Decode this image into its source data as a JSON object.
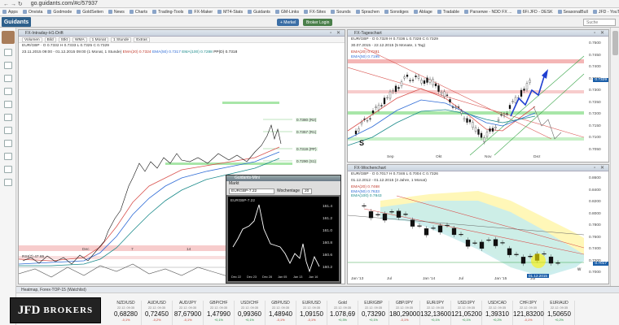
{
  "browser": {
    "url": "go.guidants.com/#c/57937",
    "nav": "← → ↻"
  },
  "bookmarks": [
    "Apps",
    "Onvista",
    "Godmode",
    "GoldSeiten",
    "News",
    "Charts",
    "Trading-Tools",
    "FX-Maker",
    "MT4-Stats",
    "Guidants",
    "GM-Links",
    "FX-Sites",
    "Sounds",
    "Sprachen",
    "Sonstiges",
    "Ablage",
    "Tradable",
    "Parserwe - NDD FX ...",
    "6Fi JFD - DESK",
    "SeasonalBull",
    "JFD - YouTube"
  ],
  "app": {
    "logo": "Guidants",
    "btn_merkel": "+ Merkel",
    "btn_broker": "Broker Login",
    "search": "Suche"
  },
  "left_chart": {
    "title": "FX-Intraday-H1-Drift",
    "toolbar": [
      "Volumen",
      "Bild",
      "Stkt",
      "WMA",
      "1 Monat",
      "1 Stunde",
      "Extras"
    ],
    "info_line1": "EUR/GBP · O 0.7332  H 0.7333  L 0.7325  C 0.7329",
    "info_line2_prefix": "23.11.2015 09:00 - 01.12.2015 09:00 (1 Monat, 1 Stunde)",
    "ema20": "EMA(20) 0.7324",
    "ema50": "EMA(50) 0.7317",
    "ema100": "EMA(100) 0.7288",
    "pp": "PP(D) 0.7318",
    "levels": [
      {
        "label": "0.7380 (R2)",
        "y": 92
      },
      {
        "label": "0.7357 (R1)",
        "y": 107
      },
      {
        "label": "0.7319 (PP)",
        "y": 128
      },
      {
        "label": "0.7290 (S1)",
        "y": 143
      },
      {
        "label": "0.7251 (S2)",
        "y": 163
      },
      {
        "label": "0.7223 (S3)",
        "y": 178
      }
    ],
    "xlabels": [
      "Dec",
      "7",
      "14"
    ],
    "rsi_label": "RSI(7)  47.65"
  },
  "right_top": {
    "title": "FX-Tageschart",
    "info_line1": "EUR/GBP · O 0.7329  H 0.7336  L 0.7328  C 0.7329",
    "info_line2": "30.07.2015 - 22.12.2015 (5 Monate, 1 Tag)",
    "ema20": "EMA(20) 0.7281",
    "ema50": "EMA(50) 0.7195",
    "ema100": "EMA(100) 0.7220",
    "yticks": [
      "0.7500",
      "0.7450",
      "0.7400",
      "0.7350",
      "0.7300",
      "0.7250",
      "0.7200",
      "0.7150",
      "0.7100",
      "0.7050"
    ],
    "xlabels": [
      "Sep",
      "Okt",
      "Nov",
      "Dez"
    ],
    "price_tag": "0.7329",
    "s_label": "S"
  },
  "right_bottom": {
    "title": "FX-Wochenchart",
    "info_line1": "EUR/GBP · O 0.7017  H 0.7346  L 0.7004  C 0.7326",
    "info_line2": "01.12.2012 - 01.12.2015 (3 Jahre, 1 Monat)",
    "ema20": "EMA(20) 0.7468",
    "ema50": "EMA(50) 0.7633",
    "ema100": "EMA(100) 0.7843",
    "yticks": [
      "0.8600",
      "0.8400",
      "0.8200",
      "0.8000",
      "0.7800",
      "0.7600",
      "0.7400",
      "0.7200",
      "0.7000"
    ],
    "xlabels": [
      "Jan '13",
      "Jul",
      "Jan '14",
      "Jul",
      "Jan '15",
      "Jul"
    ],
    "price_tag": "0.7017",
    "date_tag": "01.12.2015"
  },
  "float_window": {
    "title": "Guidants-Mini",
    "sub": "Markt",
    "symbol": "EURGBP-7.22",
    "label": "Wochentage",
    "num": "20",
    "yticks": [
      "161.4",
      "161.2",
      "161.0",
      "160.8",
      "160.6",
      "160.2"
    ],
    "xlabels": [
      "Dec 22",
      "Dec 23",
      "Dec 28",
      "Jan 05",
      "Jan 13",
      "Jan 16"
    ]
  },
  "quotebar": {
    "title": "Heatmap, Forex-TOP-15 (Watchlist)",
    "quotes": [
      {
        "sym": "NZD/USD",
        "px": "0,68280",
        "ch": "-0,1%",
        "up": false
      },
      {
        "sym": "AUD/USD",
        "px": "0,72450",
        "ch": "-0,2%",
        "up": false
      },
      {
        "sym": "AUD/JPY",
        "px": "87,67900",
        "ch": "-0,1%",
        "up": false
      },
      {
        "sym": "GBP/CHF",
        "px": "1,47990",
        "ch": "+0,1%",
        "up": true
      },
      {
        "sym": "USD/CHF",
        "px": "0,99360",
        "ch": "+0,1%",
        "up": true
      },
      {
        "sym": "GBP/USD",
        "px": "1,48940",
        "ch": "-0,1%",
        "up": false
      },
      {
        "sym": "EUR/USD",
        "px": "1,09150",
        "ch": "-0,1%",
        "up": false
      },
      {
        "sym": "Gold",
        "px": "1.078,69",
        "ch": "+0,3%",
        "up": true
      },
      {
        "sym": "EUR/GBP",
        "px": "0,73290",
        "ch": "+0,1%",
        "up": true
      },
      {
        "sym": "GBP/JPY",
        "px": "180,29000",
        "ch": "-0,1%",
        "up": false
      },
      {
        "sym": "EUR/JPY",
        "px": "132,13600",
        "ch": "+0,1%",
        "up": true
      },
      {
        "sym": "USD/JPY",
        "px": "121,05200",
        "ch": "+0,1%",
        "up": true
      },
      {
        "sym": "USD/CAD",
        "px": "1,39310",
        "ch": "+0,2%",
        "up": true
      },
      {
        "sym": "CHF/JPY",
        "px": "121,83200",
        "ch": "-0,1%",
        "up": false
      },
      {
        "sym": "EUR/AUD",
        "px": "1,50650",
        "ch": "+0,2%",
        "up": true
      }
    ],
    "sub": "22.12. 09:35",
    "brand_j": "JFD",
    "brand_b": "BROKERS"
  }
}
